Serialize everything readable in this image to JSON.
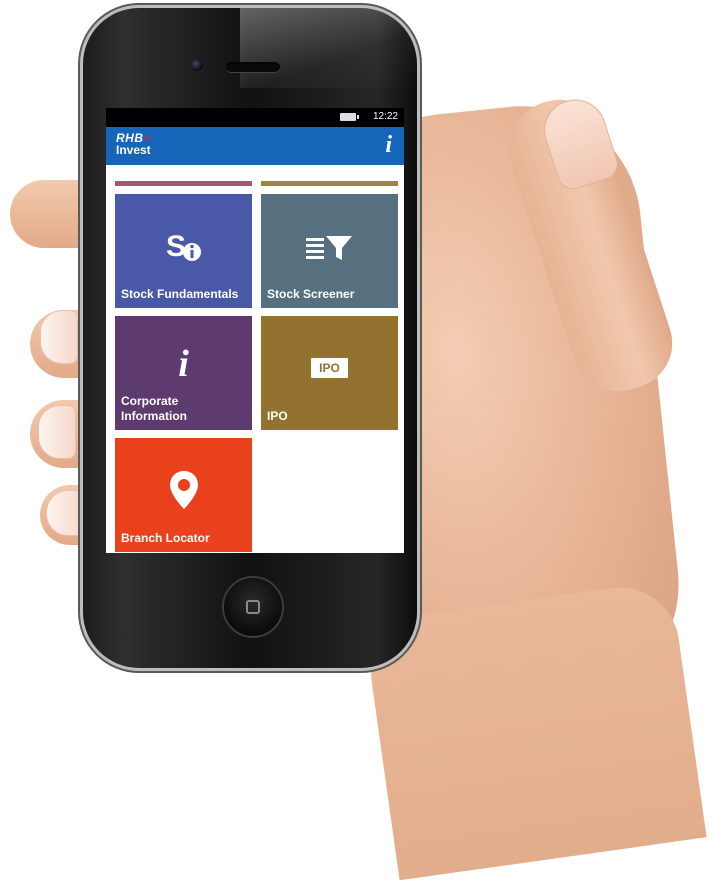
{
  "status_bar": {
    "time": "12:22"
  },
  "header": {
    "brand_top": "RHB",
    "brand_plus": "+",
    "brand_bottom": "Invest",
    "info_glyph": "i"
  },
  "accent_bars": [
    "#a1596b",
    "#9a8548"
  ],
  "tiles": [
    {
      "label": "Stock Fundamentals",
      "icon": "stock-fundamentals-icon",
      "color": "#4a59a7"
    },
    {
      "label": "Stock Screener",
      "icon": "filter-funnel-icon",
      "color": "#56707f"
    },
    {
      "label": "Corporate Information",
      "icon": "info-icon",
      "color": "#5e3b6e"
    },
    {
      "label": "IPO",
      "icon": "ipo-badge-icon",
      "icon_text": "IPO",
      "color": "#93712e"
    },
    {
      "label": "Branch Locator",
      "icon": "map-pin-icon",
      "color": "#e8411b"
    }
  ],
  "colors": {
    "header": "#1565b8",
    "brand_plus": "#e8222b"
  }
}
